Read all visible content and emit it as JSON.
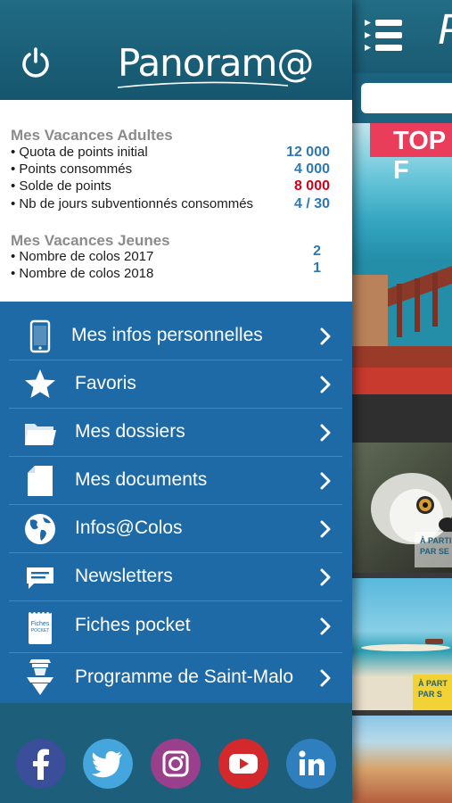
{
  "app": {
    "logo_text": "Panoram@",
    "behind_logo": "P"
  },
  "stats": {
    "adults": {
      "title": "Mes Vacances Adultes",
      "rows": [
        {
          "label": "• Quota de points initial",
          "value": "12 000"
        },
        {
          "label": "• Points consommés",
          "value": "4 000"
        },
        {
          "label": "• Solde de points",
          "value": "8 000"
        },
        {
          "label": "• Nb de jours subventionnés consommés",
          "value": "4 / 30"
        }
      ]
    },
    "youth": {
      "title": "Mes Vacances Jeunes",
      "rows": [
        {
          "label": "• Nombre de colos 2017",
          "value": "2"
        },
        {
          "label": "• Nombre de colos 2018",
          "value": "1"
        }
      ]
    }
  },
  "menu": {
    "items": [
      {
        "label": "Mes infos personnelles",
        "icon": "smartphone-icon"
      },
      {
        "label": "Favoris",
        "icon": "star-icon"
      },
      {
        "label": "Mes dossiers",
        "icon": "folder-icon"
      },
      {
        "label": "Mes documents",
        "icon": "document-icon"
      },
      {
        "label": "Infos@Colos",
        "icon": "globe-icon"
      },
      {
        "label": "Newsletters",
        "icon": "newsletter-icon"
      },
      {
        "label": "Fiches pocket",
        "icon": "fiches-pocket-icon",
        "icon_text": "Fiches POCKET"
      },
      {
        "label": "Programme de Saint-Malo",
        "icon": "sailor-icon"
      }
    ]
  },
  "social": [
    "facebook-icon",
    "twitter-icon",
    "instagram-icon",
    "youtube-icon",
    "linkedin-icon"
  ],
  "behind": {
    "banner_text": "TOP F",
    "tag1": "À PARTIR PAR SE",
    "tag2": "À PART PAR S"
  },
  "colors": {
    "header": "#1c6480",
    "menu": "#1e6aa6",
    "value_blue": "#2e78b3",
    "value_red": "#d0021b"
  }
}
